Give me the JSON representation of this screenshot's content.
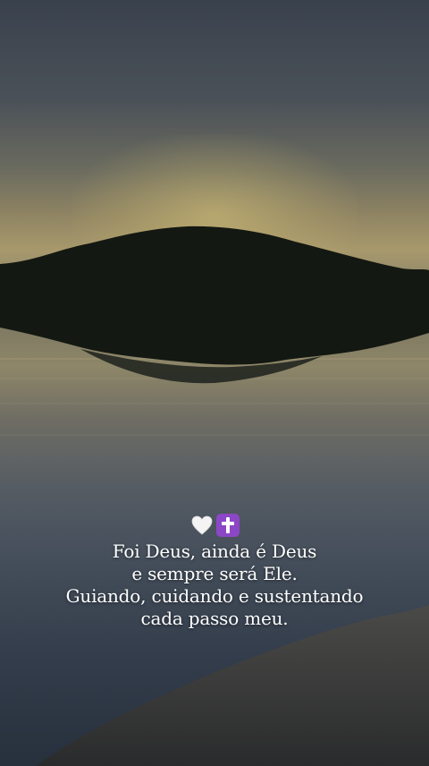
{
  "emojis": [
    "white-heart-icon",
    "latin-cross-icon"
  ],
  "caption": {
    "lines": [
      "Foi Deus, ainda é Deus",
      "e sempre será Ele.",
      "Guiando, cuidando e sustentando",
      "cada passo meu."
    ]
  },
  "colors": {
    "text": "#ffffff",
    "cross_bg": "#8c47c6"
  }
}
